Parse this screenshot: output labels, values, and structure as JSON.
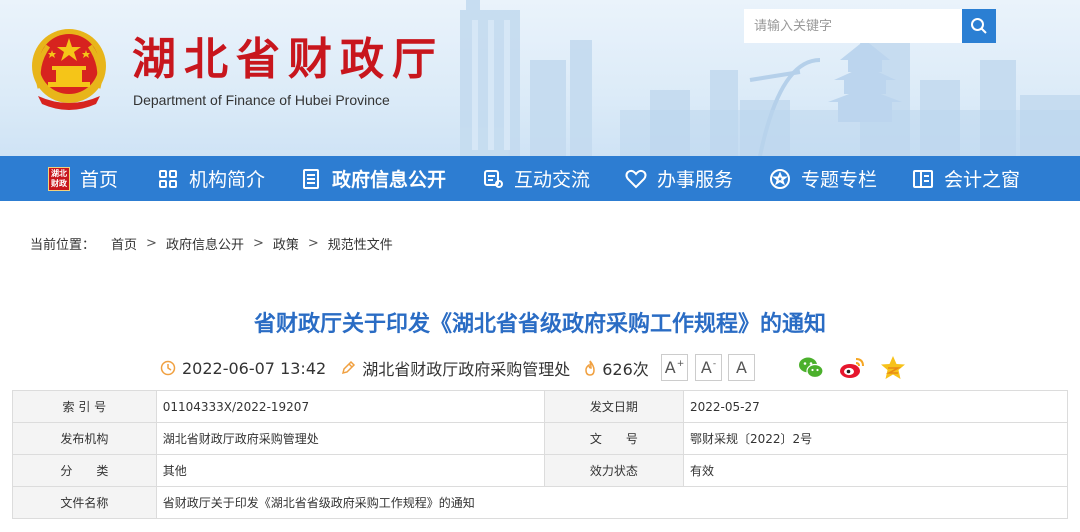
{
  "header": {
    "title": "湖北省财政厅",
    "subtitle": "Department of Finance of Hubei Province",
    "search_placeholder": "请输入关键字"
  },
  "nav": {
    "items": [
      {
        "label": "首页",
        "icon": "hubei-finance-badge",
        "badge": [
          "湖北",
          "财政"
        ]
      },
      {
        "label": "机构简介",
        "icon": "grid-icon"
      },
      {
        "label": "政府信息公开",
        "icon": "document-list-icon"
      },
      {
        "label": "互动交流",
        "icon": "chat-icon"
      },
      {
        "label": "办事服务",
        "icon": "heart-icon"
      },
      {
        "label": "专题专栏",
        "icon": "star-circle-icon"
      },
      {
        "label": "会计之窗",
        "icon": "window-icon"
      }
    ],
    "active_index": 2
  },
  "breadcrumb": {
    "label": "当前位置：",
    "items": [
      "首页",
      "政府信息公开",
      "政策",
      "规范性文件"
    ],
    "separator": ">"
  },
  "article": {
    "title": "省财政厅关于印发《湖北省省级政府采购工作规程》的通知",
    "datetime": "2022-06-07 13:42",
    "source": "湖北省财政厅政府采购管理处",
    "views": "626次",
    "font_buttons": [
      "A",
      "A",
      "A"
    ]
  },
  "info_table": {
    "rows": [
      {
        "label": "索 引 号",
        "value": "01104333X/2022-19207",
        "label2": "发文日期",
        "value2": "2022-05-27"
      },
      {
        "label": "发布机构",
        "value": "湖北省财政厅政府采购管理处",
        "label2": "文　　号",
        "value2": "鄂财采规〔2022〕2号"
      },
      {
        "label": "分　　类",
        "value": "其他",
        "label2": "效力状态",
        "value2": "有效"
      },
      {
        "label": "文件名称",
        "value": "省财政厅关于印发《湖北省省级政府采购工作规程》的通知"
      }
    ]
  },
  "colors": {
    "nav_bg": "#2d7dd2",
    "title_red": "#c8161d",
    "article_blue": "#2a6cc4"
  }
}
